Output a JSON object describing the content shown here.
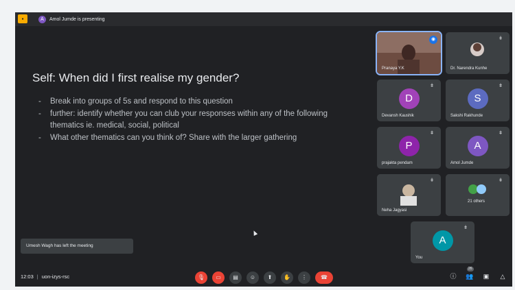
{
  "topbar": {
    "logo_icon": "slides-logo-icon",
    "presenter_initial": "A",
    "presenting_text": "Amol Jumde is presenting"
  },
  "slide": {
    "title": "Self: When did I first realise my gender?",
    "bullets": [
      "Break into groups of 5s and respond to this question",
      "further: identify whether you can club your responses within any of the following thematics ie. medical, social, political",
      "What other thematics can you think of? Share with the larger gathering"
    ]
  },
  "toast": "Umesh Wagh has left the meeting",
  "participants": [
    {
      "name": "Pranaya Y.K",
      "type": "video",
      "speaking": true
    },
    {
      "name": "Dr. Narendra Kunhe",
      "type": "video"
    },
    {
      "name": "Devansh Kaushik",
      "initial": "D",
      "color": "#a142b8"
    },
    {
      "name": "Sakshi Rakhunde",
      "initial": "S",
      "color": "#5c6bc0"
    },
    {
      "name": "prajakta pendam",
      "initial": "P",
      "color": "#8e24aa"
    },
    {
      "name": "Amol Jumde",
      "initial": "A",
      "color": "#7e57c2"
    },
    {
      "name": "Neha Jagyasi",
      "type": "video"
    },
    {
      "name": "21 others",
      "type": "others"
    },
    {
      "name": "You",
      "initial": "A",
      "color": "#0097a7"
    }
  ],
  "bottombar": {
    "time": "12:03",
    "separator": "|",
    "meeting_code": "uon-izys-rsc",
    "people_count": "26"
  }
}
